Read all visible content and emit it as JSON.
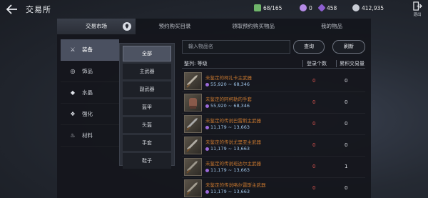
{
  "header": {
    "title": "交易所",
    "resources": [
      {
        "icon": "bag-icon",
        "value": "68/165",
        "color": "#6fb56a"
      },
      {
        "icon": "orb-icon",
        "value": "0",
        "color": "#b58be6"
      },
      {
        "icon": "crystal-icon",
        "value": "458",
        "color": "#8e5fd1"
      },
      {
        "icon": "silver-coin-icon",
        "value": "412,935",
        "color": "#c8ccd4"
      }
    ],
    "exit_label": "退出"
  },
  "tabs": [
    {
      "label": "交易市场",
      "active": true
    },
    {
      "label": "预约购买目录",
      "active": false
    },
    {
      "label": "领取预约购买物品",
      "active": false
    },
    {
      "label": "我的物品",
      "active": false
    }
  ],
  "categories": [
    {
      "label": "装备",
      "icon": "crossed-swords-icon",
      "active": true
    },
    {
      "label": "饰品",
      "icon": "ring-icon",
      "active": false
    },
    {
      "label": "水晶",
      "icon": "crystal-icon",
      "active": false
    },
    {
      "label": "强化",
      "icon": "enhance-icon",
      "active": false
    },
    {
      "label": "材料",
      "icon": "potion-icon",
      "active": false
    }
  ],
  "subcategories": [
    {
      "label": "全部",
      "active": true
    },
    {
      "label": "主武器",
      "active": false
    },
    {
      "label": "副武器",
      "active": false
    },
    {
      "label": "盔甲",
      "active": false
    },
    {
      "label": "头盔",
      "active": false
    },
    {
      "label": "手套",
      "active": false
    },
    {
      "label": "鞋子",
      "active": false
    }
  ],
  "search": {
    "placeholder": "输入物品名",
    "query_label": "查询",
    "refresh_label": "刷新"
  },
  "list": {
    "sort_label": "整列: 等级",
    "count_label": "登录个数",
    "volume_label": "累积交易量",
    "rows": [
      {
        "name": "未鉴定的柯扎卡主武器",
        "price": "55,920 ~ 68,346",
        "count": "0",
        "volume": "0"
      },
      {
        "name": "未鉴定的阿柯勒的手套",
        "price": "55,920 ~ 68,346",
        "count": "0",
        "volume": "0"
      },
      {
        "name": "未鉴定的传说巴雷斯主武器",
        "price": "11,179 ~ 13,663",
        "count": "0",
        "volume": "0"
      },
      {
        "name": "未鉴定的传说尤里亚主武器",
        "price": "11,179 ~ 13,663",
        "count": "0",
        "volume": "0"
      },
      {
        "name": "未鉴定的传说班达尔主武器",
        "price": "11,179 ~ 13,663",
        "count": "0",
        "volume": "1"
      },
      {
        "name": "未鉴定的传说咯尔雷斯主武器",
        "price": "11,179 ~ 13,663",
        "count": "0",
        "volume": "0"
      }
    ]
  },
  "colors": {
    "item_name": "#c7772f",
    "count": "#d9534f",
    "price": "#9ec3e6"
  }
}
